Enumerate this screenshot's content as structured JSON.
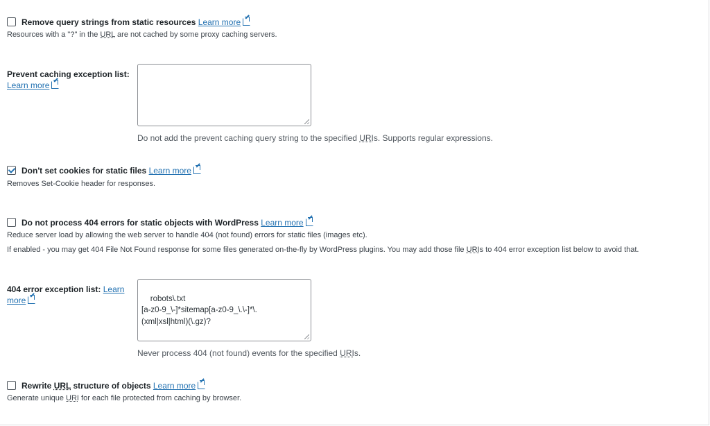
{
  "options": {
    "remove_query": {
      "checked": false,
      "title": "Remove query strings from static resources",
      "link": "Learn more",
      "desc_a": "Resources with a \"?\" in the ",
      "desc_abbr": "URL",
      "desc_b": " are not cached by some proxy caching servers."
    },
    "prevent_caching": {
      "label": "Prevent caching exception list:",
      "link": "Learn more",
      "value": "",
      "help_a": "Do not add the prevent caching query string to the specified ",
      "help_abbr": "URI",
      "help_b": "s. Supports regular expressions."
    },
    "no_cookies": {
      "checked": true,
      "title": "Don't set cookies for static files",
      "link": "Learn more",
      "desc": "Removes Set-Cookie header for responses."
    },
    "no_404": {
      "checked": false,
      "title": "Do not process 404 errors for static objects with WordPress",
      "link": "Learn more",
      "desc1": "Reduce server load by allowing the web server to handle 404 (not found) errors for static files (images etc).",
      "desc2_a": "If enabled - you may get 404 File Not Found response for some files generated on-the-fly by WordPress plugins. You may add those file ",
      "desc2_abbr": "URI",
      "desc2_b": "s to 404 error exception list below to avoid that."
    },
    "exception_404": {
      "label": "404 error exception list:",
      "link_part1": "Learn",
      "link_part2": "more",
      "value": "robots\\.txt\n[a-z0-9_\\-]*sitemap[a-z0-9_\\.\\-]*\\.\n(xml|xsl|html)(\\.gz)?",
      "help_a": "Never process 404 (not found) events for the specified ",
      "help_abbr": "URI",
      "help_b": "s."
    },
    "rewrite_url": {
      "checked": false,
      "title_a": "Rewrite ",
      "title_abbr": "URL",
      "title_b": " structure of objects",
      "link": "Learn more",
      "desc_a": "Generate unique ",
      "desc_abbr": "URI",
      "desc_b": " for each file protected from caching by browser."
    }
  }
}
